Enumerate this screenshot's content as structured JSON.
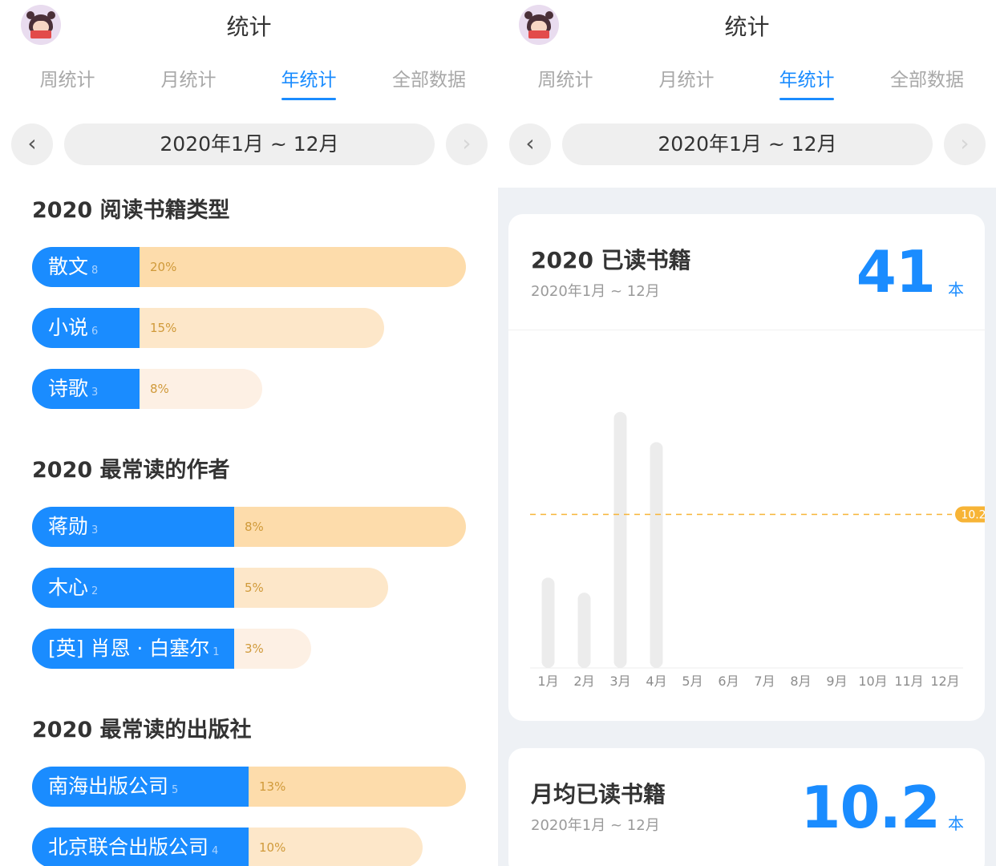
{
  "header": {
    "title": "统计",
    "tabs": [
      "周统计",
      "月统计",
      "年统计",
      "全部数据"
    ],
    "active_tab": "年统计",
    "range": "2020年1月 ~ 12月",
    "prev_icon": "chevron-left-icon",
    "next_icon": "chevron-right-icon"
  },
  "left": {
    "sections": [
      {
        "title": "2020 阅读书籍类型",
        "items": [
          {
            "label": "散文",
            "count": "8",
            "percent": "20%",
            "share": 0.2
          },
          {
            "label": "小说",
            "count": "6",
            "percent": "15%",
            "share": 0.15
          },
          {
            "label": "诗歌",
            "count": "3",
            "percent": "8%",
            "share": 0.08
          }
        ]
      },
      {
        "title": "2020 最常读的作者",
        "items": [
          {
            "label": "蒋勋",
            "count": "3",
            "percent": "8%",
            "share": 0.08
          },
          {
            "label": "木心",
            "count": "2",
            "percent": "5%",
            "share": 0.05
          },
          {
            "label": "[英] 肖恩 · 白塞尔",
            "count": "1",
            "percent": "3%",
            "share": 0.03
          }
        ]
      },
      {
        "title": "2020 最常读的出版社",
        "items": [
          {
            "label": "南海出版公司",
            "count": "5",
            "percent": "13%",
            "share": 0.13
          },
          {
            "label": "北京联合出版公司",
            "count": "4",
            "percent": "10%",
            "share": 0.1
          }
        ]
      }
    ]
  },
  "right": {
    "card1": {
      "title": "2020 已读书籍",
      "subtitle": "2020年1月 ~ 12月",
      "value": "41",
      "unit": "本"
    },
    "card2": {
      "title": "月均已读书籍",
      "subtitle": "2020年1月 ~ 12月",
      "value": "10.2",
      "unit": "本"
    }
  },
  "chart_data": {
    "type": "bar",
    "categories": [
      "1月",
      "2月",
      "3月",
      "4月",
      "5月",
      "6月",
      "7月",
      "8月",
      "9月",
      "10月",
      "11月",
      "12月"
    ],
    "values": [
      6,
      5,
      17,
      15,
      0,
      0,
      0,
      0,
      0,
      0,
      0,
      0
    ],
    "reference_line": {
      "value": 10.2,
      "label": "10.2"
    },
    "ylim": [
      0,
      18
    ],
    "bar_color": "#ececec",
    "reference_color": "#f7b436",
    "grid": false
  },
  "colors": {
    "accent": "#1a8cff",
    "bar_fill_strong": "#fddcab",
    "bar_fill_mid": "#fde7c9",
    "bar_fill_light": "#fdf0e4"
  }
}
